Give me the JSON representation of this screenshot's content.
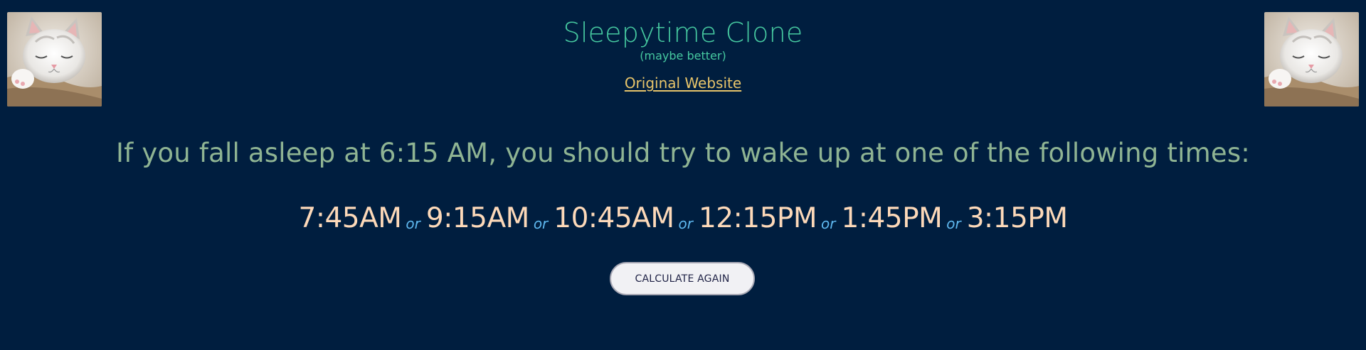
{
  "header": {
    "title": "Sleepytime Clone",
    "subtitle": "(maybe better)",
    "original_link": "Original Website"
  },
  "images": {
    "left": "sleeping-kitten-image",
    "right": "sleeping-kitten-image"
  },
  "result": {
    "message": "If you fall asleep at 6:15 AM, you should try to wake up at one of the following times:",
    "times": [
      "7:45AM",
      "9:15AM",
      "10:45AM",
      "12:15PM",
      "1:45PM",
      "3:15PM"
    ],
    "separator": "or"
  },
  "button": {
    "label": "CALCULATE AGAIN"
  },
  "colors": {
    "background": "#001e3f",
    "title": "#46c9a0",
    "link": "#e8c56a",
    "message": "#8fb493",
    "time": "#fdd9b9",
    "separator": "#5fb9f0"
  }
}
